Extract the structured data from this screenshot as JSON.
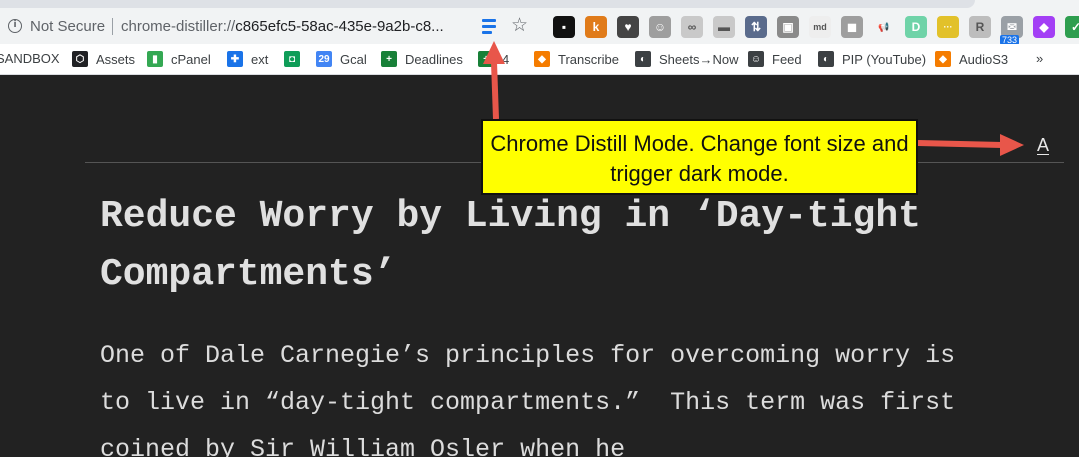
{
  "browser": {
    "security_label": "Not Secure",
    "url_scheme": "chrome-distiller://",
    "url_rest": "c865efc5-58ac-435e-9a2b-c8...",
    "extensions": [
      {
        "name": "notion-icon",
        "glyph": "▪",
        "bg": "#111111"
      },
      {
        "name": "k-extension-icon",
        "glyph": "k",
        "bg": "#e07b1a"
      },
      {
        "name": "shield-extension-icon",
        "glyph": "♥",
        "bg": "#444444"
      },
      {
        "name": "robot-extension-icon",
        "glyph": "☺",
        "bg": "#9e9e9e"
      },
      {
        "name": "glasses-extension-icon",
        "glyph": "∞",
        "bg": "#c9c9c9"
      },
      {
        "name": "chat-extension-icon",
        "glyph": "▬",
        "bg": "#c9c9c9"
      },
      {
        "name": "sort-extension-icon",
        "glyph": "⇅",
        "bg": "#5a6b8c"
      },
      {
        "name": "screenshot-extension-icon",
        "glyph": "▣",
        "bg": "#8a8a8a"
      },
      {
        "name": "markdown-extension-icon",
        "glyph": "md",
        "bg": "#eeeeee"
      },
      {
        "name": "comment-extension-icon",
        "glyph": "◼",
        "bg": "#9e9e9e"
      },
      {
        "name": "megaphone-extension-icon",
        "glyph": "📢",
        "bg": "#f1f3f4"
      },
      {
        "name": "d-extension-icon",
        "glyph": "D",
        "bg": "#6fd3a8"
      },
      {
        "name": "dots-extension-icon",
        "glyph": "···",
        "bg": "#e2c12a"
      },
      {
        "name": "puzzle-extension-icon",
        "glyph": "R",
        "bg": "#bdbdbd"
      },
      {
        "name": "mail-extension-icon",
        "glyph": "✉",
        "bg": "#9aa0a6",
        "badge": "733"
      },
      {
        "name": "grammarly-extension-icon",
        "glyph": "◆",
        "bg": "#a33ff5"
      },
      {
        "name": "check-extension-icon",
        "glyph": "✓",
        "bg": "#2e9e4f"
      }
    ],
    "bookmarks": [
      {
        "label": "SANDBOX",
        "icon": "none",
        "bg": ""
      },
      {
        "label": "Assets",
        "icon": "codepen-icon",
        "glyph": "⬡",
        "bg": "#202124"
      },
      {
        "label": "cPanel",
        "icon": "cpanel-icon",
        "glyph": "▮",
        "bg": "#34a853"
      },
      {
        "label": "ext",
        "icon": "puzzle-icon",
        "glyph": "✚",
        "bg": "#1a73e8"
      },
      {
        "label": "",
        "icon": "hangouts-icon",
        "glyph": "◘",
        "bg": "#0f9d58"
      },
      {
        "label": "Gcal",
        "icon": "calendar-icon",
        "glyph": "29",
        "bg": "#4285f4"
      },
      {
        "label": "Deadlines",
        "icon": "sheets-plus-icon",
        "glyph": "+",
        "bg": "#188038"
      },
      {
        "label": "4",
        "icon": "sheets-plus-icon",
        "glyph": "+",
        "bg": "#188038"
      },
      {
        "label": "Transcribe",
        "icon": "box-icon",
        "glyph": "◆",
        "bg": "#f57c00"
      },
      {
        "label": "Sheets→Now",
        "icon": "globe-icon",
        "glyph": "◐",
        "bg": "#3c4043"
      },
      {
        "label": "Feed",
        "icon": "feed-icon",
        "glyph": "☺",
        "bg": "#3c4043"
      },
      {
        "label": "PIP (YouTube)",
        "icon": "globe-icon",
        "glyph": "◐",
        "bg": "#3c4043"
      },
      {
        "label": "AudioS3",
        "icon": "box-icon",
        "glyph": "◆",
        "bg": "#f57c00"
      },
      {
        "label": "»",
        "icon": "none",
        "bg": ""
      }
    ]
  },
  "article": {
    "font_toggle": "A",
    "title": "Reduce Worry by Living in ‘Day-tight Compartments’",
    "paragraph": "One of Dale Carnegie’s principles for overcoming worry is to live in “day-tight compartments.”  This term was first coined by Sir William Osler when he"
  },
  "annotation": {
    "text": "Chrome Distill Mode. Change font size and trigger dark mode.",
    "arrow_color": "#e8564a"
  }
}
